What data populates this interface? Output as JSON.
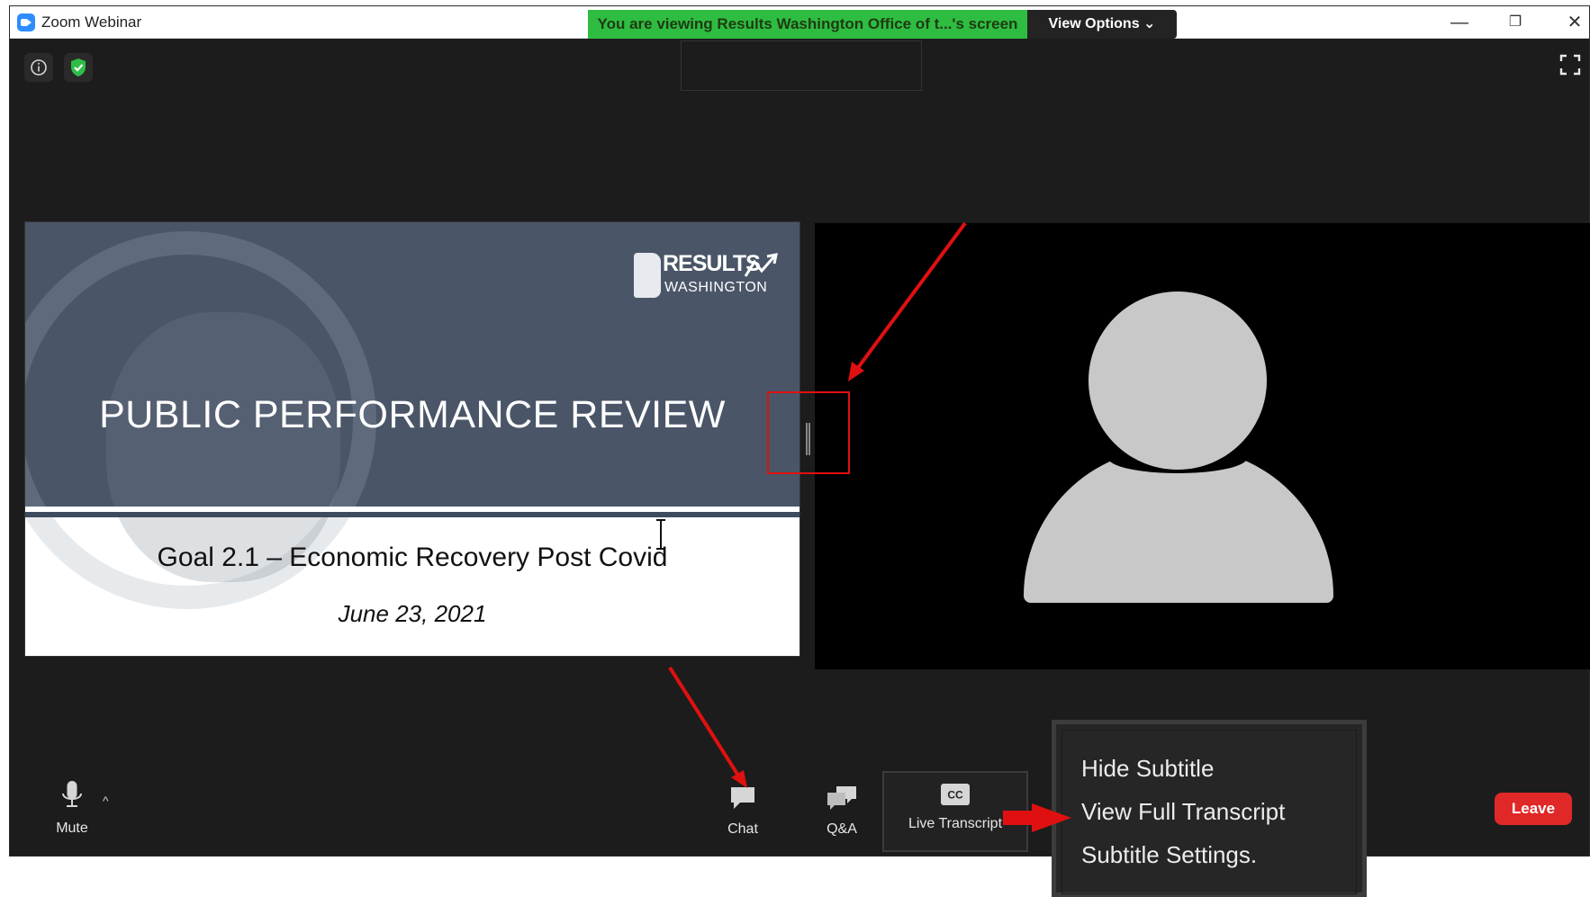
{
  "window": {
    "title": "Zoom Webinar",
    "share_banner": "You are viewing Results Washington Office of t...'s screen",
    "view_options": "View Options ⌄",
    "minimize": "—",
    "maximize": "❐",
    "close": "✕"
  },
  "slide": {
    "logo_line1": "RESULTS",
    "logo_line2": "WASHINGTON",
    "title": "PUBLIC PERFORMANCE REVIEW",
    "subtitle": "Goal 2.1 – Economic Recovery Post Covid",
    "date": "June 23, 2021"
  },
  "toolbar": {
    "mute_label": "Mute",
    "mute_caret": "^",
    "chat_label": "Chat",
    "qa_label": "Q&A",
    "live_transcript_label": "Live Transcript",
    "cc_badge": "CC",
    "leave_label": "Leave"
  },
  "menu": {
    "items": [
      "Hide Subtitle",
      "View Full Transcript",
      "Subtitle Settings."
    ]
  },
  "colors": {
    "banner_green": "#2ebd41",
    "leave_red": "#e02828",
    "annotation_red": "#e01010",
    "slide_navy": "#4a5568"
  }
}
